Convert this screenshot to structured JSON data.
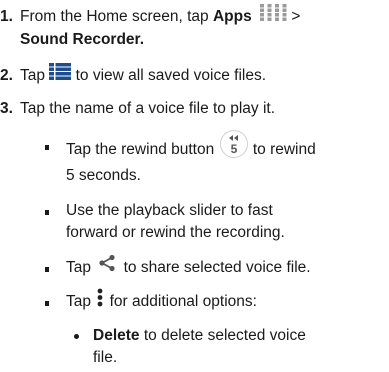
{
  "steps": [
    {
      "number": "1.",
      "line1_pre": "From the Home screen, tap ",
      "line1_bold": "Apps",
      "line1_post": " >",
      "line2_bold": "Sound Recorder."
    },
    {
      "number": "2.",
      "pre": "Tap ",
      "post": " to view all saved voice files."
    },
    {
      "number": "3.",
      "text": "Tap the name of a voice file to play it."
    }
  ],
  "bullets": {
    "rewind": {
      "pre": "Tap the rewind button ",
      "post": " to rewind",
      "line2": "5 seconds.",
      "icon_label": "5"
    },
    "slider": {
      "line1": "Use the playback slider to fast",
      "line2": "forward or rewind the recording."
    },
    "share": {
      "pre": "Tap ",
      "post": " to share selected voice file."
    },
    "more": {
      "pre": "Tap ",
      "post": " for additional options:"
    }
  },
  "sub_bullets": {
    "delete": {
      "bold": "Delete",
      "line1_post": " to delete selected voice",
      "line2": "file."
    }
  },
  "icons": {
    "apps": "apps-grid-icon",
    "list": "list-icon",
    "rewind": "rewind-5-icon",
    "share": "share-icon",
    "more": "more-vertical-icon"
  },
  "colors": {
    "icon_gray": "#9a9a9a",
    "text": "#1a1a1a"
  }
}
